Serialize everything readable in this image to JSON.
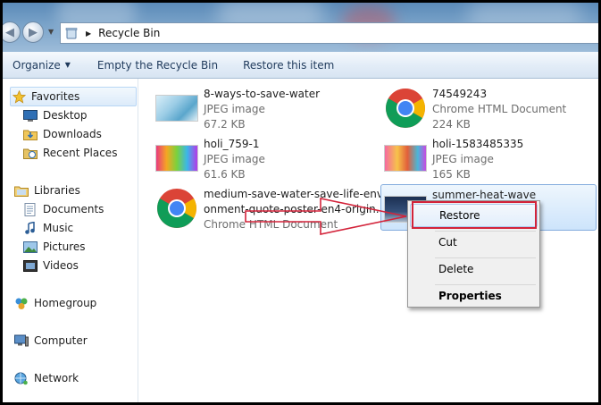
{
  "window": {
    "address": {
      "location": "Recycle Bin"
    }
  },
  "toolbar": {
    "organize_label": "Organize",
    "empty_label": "Empty the Recycle Bin",
    "restore_label": "Restore this item"
  },
  "navigation": {
    "favorites": "Favorites",
    "desktop": "Desktop",
    "downloads": "Downloads",
    "recent": "Recent Places",
    "libraries": "Libraries",
    "documents": "Documents",
    "music": "Music",
    "pictures": "Pictures",
    "videos": "Videos",
    "homegroup": "Homegroup",
    "computer": "Computer",
    "network": "Network"
  },
  "files": [
    {
      "name": "8-ways-to-save-water",
      "type": "JPEG image",
      "size": "67.2 KB",
      "icon": "photo-thumbnail"
    },
    {
      "name": "74549243",
      "type": "Chrome HTML Document",
      "size": "224 KB",
      "icon": "chrome-icon"
    },
    {
      "name": "holi_759-1",
      "type": "JPEG image",
      "size": "61.6 KB",
      "icon": "photo-thumbnail"
    },
    {
      "name": "holi-1583485335",
      "type": "JPEG image",
      "size": "165 KB",
      "icon": "photo-thumbnail"
    },
    {
      "name_line1": "medium-save-water-save-life-envir",
      "name_line2": "onment-quote-poster-en4-origin...",
      "type": "Chrome HTML Document",
      "icon": "chrome-icon"
    },
    {
      "name": "summer-heat-wave",
      "icon": "photo-thumbnail",
      "selected": true
    }
  ],
  "context_menu": {
    "restore": "Restore",
    "cut": "Cut",
    "delete": "Delete",
    "properties": "Properties"
  },
  "colors": {
    "annotation": "#d3233a",
    "selection": "#cde4fb",
    "toolbar_text": "#1e395b"
  }
}
